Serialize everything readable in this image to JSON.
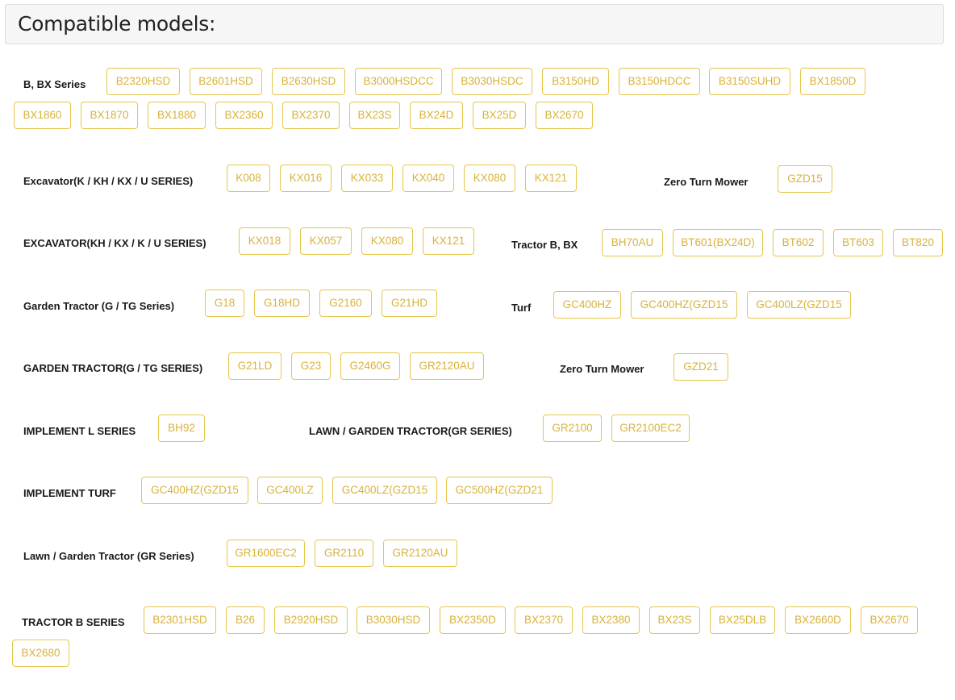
{
  "header": {
    "title": "Compatible models:"
  },
  "labels": [
    "B, BX Series",
    "Excavator(K / KH / KX / U SERIES)",
    "Zero Turn Mower",
    "EXCAVATOR(KH / KX / K / U SERIES)",
    "Tractor B, BX",
    "Garden Tractor (G / TG Series)",
    "Turf",
    "GARDEN TRACTOR(G / TG SERIES)",
    "Zero Turn Mower",
    "IMPLEMENT L SERIES",
    "LAWN / GARDEN TRACTOR(GR SERIES)",
    "IMPLEMENT TURF",
    "Lawn / Garden Tractor (GR Series)",
    "TRACTOR B SERIES"
  ],
  "models": [
    "B2320HSD",
    "B2601HSD",
    "B2630HSD",
    "B3000HSDCC",
    "B3030HSDC",
    "B3150HD",
    "B3150HDCC",
    "B3150SUHD",
    "BX1850D",
    "BX1860",
    "BX1870",
    "BX1880",
    "BX2360",
    "BX2370",
    "BX23S",
    "BX24D",
    "BX25D",
    "BX2670",
    "K008",
    "KX016",
    "KX033",
    "KX040",
    "KX080",
    "KX121",
    "GZD15",
    "KX018",
    "KX057",
    "KX080",
    "KX121",
    "BH70AU",
    "BT601(BX24D)",
    "BT602",
    "BT603",
    "BT820",
    "G18",
    "G18HD",
    "G2160",
    "G21HD",
    "GC400HZ",
    "GC400HZ(GZD15",
    "GC400LZ(GZD15",
    "G21LD",
    "G23",
    "G2460G",
    "GR2120AU",
    "GZD21",
    "BH92",
    "GR2100",
    "GR2100EC2",
    "GC400HZ(GZD15",
    "GC400LZ",
    "GC400LZ(GZD15",
    "GC500HZ(GZD21",
    "GR1600EC2",
    "GR2110",
    "GR2120AU",
    "B2301HSD",
    "B26",
    "B2920HSD",
    "B3030HSD",
    "BX2350D",
    "BX2370",
    "BX2380",
    "BX23S",
    "BX25DLB",
    "BX2660D",
    "BX2670",
    "BX2680"
  ],
  "colors": {
    "tag_border": "#e6c64a",
    "tag_text": "#d9b23a"
  }
}
